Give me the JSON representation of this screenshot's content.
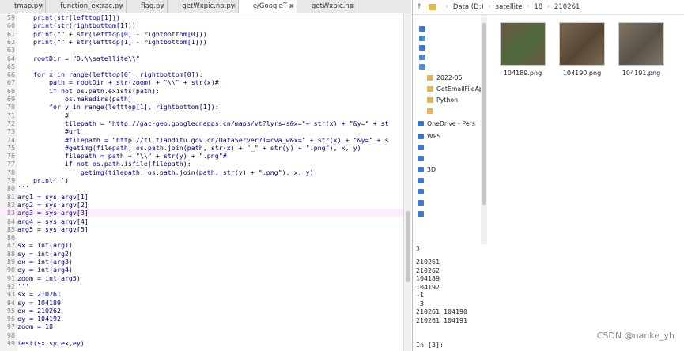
{
  "editor": {
    "tabs": [
      {
        "label": "tmap.py",
        "active": false
      },
      {
        "label": "function_extrac.py",
        "active": false
      },
      {
        "label": "flag.py",
        "active": false
      },
      {
        "label": "getWxpic.np.py",
        "active": false
      },
      {
        "label": "e/GoogleT x",
        "active": true
      },
      {
        "label": "getWxpic.np",
        "active": false
      }
    ],
    "lines": [
      {
        "n": "59",
        "t": "    print(str(lefttop[1]))"
      },
      {
        "n": "60",
        "t": "    print(str(rightbottom[1]))"
      },
      {
        "n": "61",
        "t": "    print(\"\" + str(lefttop[0] - rightbottom[0]))"
      },
      {
        "n": "62",
        "t": "    print(\"\" + str(lefttop[1] - rightbottom[1]))"
      },
      {
        "n": "63",
        "t": ""
      },
      {
        "n": "64",
        "t": "    rootDir = \"D:\\\\satellite\\\\\""
      },
      {
        "n": "65",
        "t": ""
      },
      {
        "n": "66",
        "t": "    for x in range(lefttop[0], rightbottom[0]):"
      },
      {
        "n": "67",
        "t": "        path = rootDir + str(zoom) + \"\\\\\" + str(x)#"
      },
      {
        "n": "68",
        "t": "        if not os.path.exists(path):"
      },
      {
        "n": "69",
        "t": "            os.makedirs(path)"
      },
      {
        "n": "70",
        "t": "        for y in range(lefttop[1], rightbottom[1]):"
      },
      {
        "n": "71",
        "t": "            #"
      },
      {
        "n": "72",
        "t": "            tilepath = \"http://gac-geo.googlecnapps.cn/maps/vt?lyrs=s&x=\"+ str(x) + \"&y=\" + st"
      },
      {
        "n": "73",
        "t": "            #url"
      },
      {
        "n": "74",
        "t": "            #tilepath = \"http://t1.tianditu.gov.cn/DataServer?T=cva_w&x=\" + str(x) + \"&y=\" + s"
      },
      {
        "n": "75",
        "t": "            #getimg(filepath, os.path.join(path, str(x) + \"_\" + str(y) + \".png\"), x, y)"
      },
      {
        "n": "76",
        "t": "            filepath = path + \"\\\\\" + str(y) + \".png\"#"
      },
      {
        "n": "77",
        "t": "            if not os.path.isfile(filepath):"
      },
      {
        "n": "78",
        "t": "                getimg(tilepath, os.path.join(path, str(y) + \".png\"), x, y)"
      },
      {
        "n": "79",
        "t": "    print('')"
      },
      {
        "n": "80",
        "t": "'''"
      },
      {
        "n": "81",
        "t": "arg1 = sys.argv[1]"
      },
      {
        "n": "82",
        "t": "arg2 = sys.argv[2]"
      },
      {
        "n": "83",
        "t": "arg3 = sys.argv[3]"
      },
      {
        "n": "84",
        "t": "arg4 = sys.argv[4]"
      },
      {
        "n": "85",
        "t": "arg5 = sys.argv[5]"
      },
      {
        "n": "86",
        "t": ""
      },
      {
        "n": "87",
        "t": "sx = int(arg1)"
      },
      {
        "n": "88",
        "t": "sy = int(arg2)"
      },
      {
        "n": "89",
        "t": "ex = int(arg3)"
      },
      {
        "n": "90",
        "t": "ey = int(arg4)"
      },
      {
        "n": "91",
        "t": "zoom = int(arg5)"
      },
      {
        "n": "92",
        "t": "'''"
      },
      {
        "n": "93",
        "t": "sx = 210261"
      },
      {
        "n": "94",
        "t": "sy = 104189"
      },
      {
        "n": "95",
        "t": "ex = 210262"
      },
      {
        "n": "96",
        "t": "ey = 104192"
      },
      {
        "n": "97",
        "t": "zoom = 18"
      },
      {
        "n": "98",
        "t": ""
      },
      {
        "n": "99",
        "t": "test(sx,sy,ex,ey)"
      }
    ],
    "highlighted_line_index": 24
  },
  "explorer": {
    "breadcrumb": [
      "",
      "Data (D:)",
      "satellite",
      "18",
      "210261"
    ],
    "nav_items": [
      {
        "label": "",
        "icon_color": "#3b78d8"
      },
      {
        "label": "",
        "icon_color": "#4a90d9"
      },
      {
        "label": "",
        "icon_color": "#3b78d8"
      },
      {
        "label": "",
        "icon_color": "#4a90d9"
      },
      {
        "label": "",
        "icon_color": "#4a90d9"
      },
      {
        "label": "2022-05",
        "icon_color": "#e3b64b"
      },
      {
        "label": "GetEmailFileAp",
        "icon_color": "#e3b64b"
      },
      {
        "label": "Python",
        "icon_color": "#e3b64b"
      },
      {
        "label": "",
        "icon_color": "#e3b64b"
      },
      {
        "label": "OneDrive - Pers",
        "icon_color": "#2f7bd6"
      },
      {
        "label": "WPS",
        "icon_color": "#2f7bd6"
      },
      {
        "label": "",
        "icon_color": "#3b78d8"
      },
      {
        "label": "",
        "icon_color": "#3b78d8"
      },
      {
        "label": "3D",
        "icon_color": "#3b78d8"
      },
      {
        "label": "",
        "icon_color": "#3b78d8"
      },
      {
        "label": "",
        "icon_color": "#3b78d8"
      },
      {
        "label": "",
        "icon_color": "#3b78d8"
      },
      {
        "label": "",
        "icon_color": "#3b78d8"
      }
    ],
    "status": "3",
    "files": [
      {
        "name": "104189.png",
        "colors": [
          "#6b5a45",
          "#4f6b3c"
        ]
      },
      {
        "name": "104190.png",
        "colors": [
          "#7a6a52",
          "#5a4636"
        ]
      },
      {
        "name": "104191.png",
        "colors": [
          "#7f7465",
          "#5c5347"
        ]
      }
    ]
  },
  "console": {
    "lines": [
      "210261",
      "210262",
      "104189",
      "104192",
      "-1",
      "-3",
      "210261 104190",
      "210261 104191",
      "",
      "",
      "In [3]:"
    ]
  },
  "watermark": "CSDN @nanke_yh"
}
